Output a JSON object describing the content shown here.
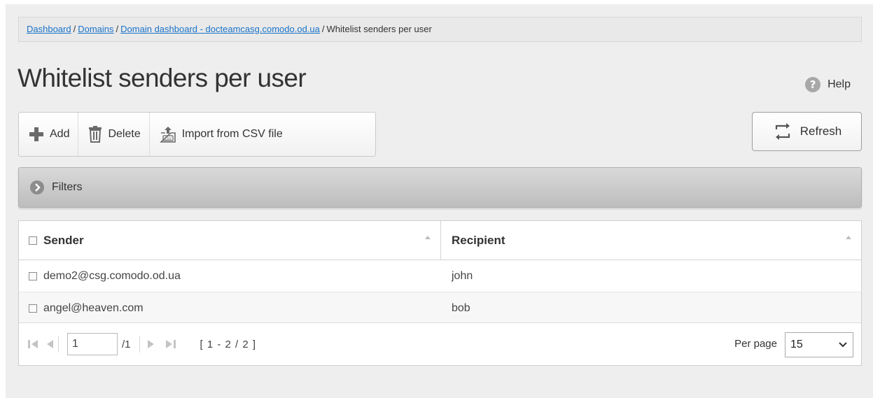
{
  "breadcrumb": {
    "items": [
      "Dashboard",
      "Domains",
      "Domain dashboard - docteamcasg.comodo.od.ua"
    ],
    "current": "Whitelist senders per user",
    "separator": "/"
  },
  "page_title": "Whitelist senders per user",
  "help_label": "Help",
  "toolbar": {
    "add_label": "Add",
    "delete_label": "Delete",
    "import_label": "Import from CSV file",
    "refresh_label": "Refresh"
  },
  "filters_label": "Filters",
  "table": {
    "columns": [
      "Sender",
      "Recipient"
    ],
    "rows": [
      {
        "sender": "demo2@csg.comodo.od.ua",
        "recipient": "john"
      },
      {
        "sender": "angel@heaven.com",
        "recipient": "bob"
      }
    ]
  },
  "pager": {
    "current_page": "1",
    "total_pages": "/1",
    "range": "[ 1 - 2 / 2 ]",
    "per_page_label": "Per page",
    "per_page_value": "15"
  },
  "colors": {
    "link": "#1a73c9",
    "page_background": "#eeeeee",
    "filters_bar": "#c8c8c8"
  }
}
